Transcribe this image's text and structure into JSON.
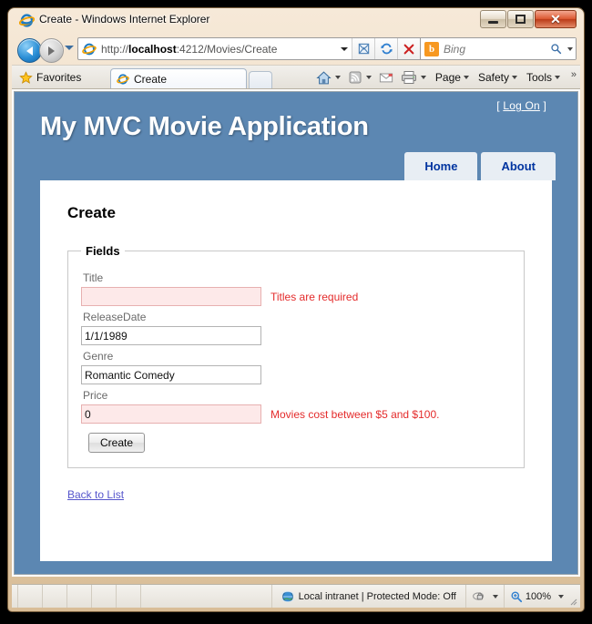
{
  "window": {
    "title": "Create - Windows Internet Explorer",
    "icon": "internet-explorer-icon",
    "minimize_label": "",
    "maximize_label": "",
    "close_label": "✕"
  },
  "navigation": {
    "back_label": "Back",
    "forward_label": "Forward",
    "history_label": "Recent Pages",
    "address": {
      "icon": "internet-explorer-icon",
      "url_scheme": "http://",
      "url_host": "localhost",
      "url_rest": ":4212/Movies/Create",
      "url_full": "http://localhost:4212/Movies/Create",
      "dropdown_label": ""
    },
    "compatibility_label": "Compatibility View",
    "refresh_label": "↻",
    "stop_label": "✕",
    "search": {
      "provider": "Bing",
      "provider_icon_letter": "b",
      "placeholder": "Bing",
      "go_label": ""
    }
  },
  "commandbar": {
    "favorites_label": "Favorites",
    "favorites_icon": "star-icon",
    "tabs": [
      {
        "label": "Create",
        "icon": "internet-explorer-icon"
      }
    ],
    "new_tab_label": "",
    "icons": [
      {
        "name": "home-icon",
        "label": ""
      },
      {
        "name": "feeds-icon",
        "label": ""
      },
      {
        "name": "mail-icon",
        "label": ""
      },
      {
        "name": "print-icon",
        "label": ""
      }
    ],
    "menus": [
      {
        "label": "Page"
      },
      {
        "label": "Safety"
      },
      {
        "label": "Tools"
      }
    ],
    "overflow_label": "»"
  },
  "site": {
    "title": "My MVC Movie Application",
    "logon_prefix": "[",
    "logon_label": "Log On",
    "logon_suffix": "]",
    "menu": [
      {
        "label": "Home"
      },
      {
        "label": "About"
      }
    ],
    "header_color": "#5c87b2",
    "menu_text_color": "#0034a0"
  },
  "page": {
    "heading": "Create",
    "fieldset_legend": "Fields",
    "fields": [
      {
        "label": "Title",
        "value": "",
        "error": "Titles are required",
        "has_error": true
      },
      {
        "label": "ReleaseDate",
        "value": "1/1/1989",
        "error": "",
        "has_error": false
      },
      {
        "label": "Genre",
        "value": "Romantic Comedy",
        "error": "",
        "has_error": false
      },
      {
        "label": "Price",
        "value": "0",
        "error": "Movies cost between $5 and $100.",
        "has_error": true
      }
    ],
    "submit_label": "Create",
    "back_link_label": "Back to List",
    "error_color": "#e42b2b",
    "link_color": "#5555cc"
  },
  "statusbar": {
    "zone_icon": "globe-icon",
    "zone_text": "Local intranet | Protected Mode: Off",
    "protection_icon": "privacy-report-icon",
    "zoom_icon": "zoom-icon",
    "zoom_level": "100%"
  }
}
